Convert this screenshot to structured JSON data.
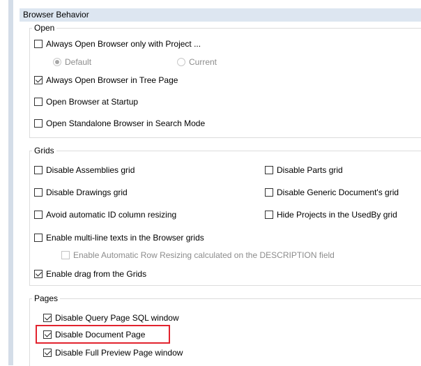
{
  "header": {
    "title": "Browser Behavior"
  },
  "open": {
    "legend": "Open",
    "always_open_project": {
      "label": "Always Open Browser only with Project ...",
      "checked": false
    },
    "radio_default": {
      "label": "Default",
      "selected": true
    },
    "radio_current": {
      "label": "Current",
      "selected": false
    },
    "always_open_tree": {
      "label": "Always Open Browser in Tree Page",
      "checked": true
    },
    "open_at_startup": {
      "label": "Open Browser at Startup",
      "checked": false
    },
    "open_standalone": {
      "label": "Open Standalone Browser in Search Mode",
      "checked": false
    }
  },
  "grids": {
    "legend": "Grids",
    "disable_assemblies": {
      "label": "Disable Assemblies grid",
      "checked": false
    },
    "disable_parts": {
      "label": "Disable Parts grid",
      "checked": false
    },
    "disable_drawings": {
      "label": "Disable Drawings grid",
      "checked": false
    },
    "disable_generic": {
      "label": "Disable Generic Document's grid",
      "checked": false
    },
    "avoid_resizing": {
      "label": "Avoid automatic ID column resizing",
      "checked": false
    },
    "hide_projects": {
      "label": "Hide Projects in the UsedBy grid",
      "checked": false
    },
    "multiline": {
      "label": "Enable multi-line texts in the Browser grids",
      "checked": false
    },
    "auto_row_resize": {
      "label": "Enable Automatic Row Resizing calculated on the DESCRIPTION field",
      "checked": false
    },
    "drag_from_grids": {
      "label": "Enable drag from the Grids",
      "checked": true
    }
  },
  "pages": {
    "legend": "Pages",
    "disable_query_sql": {
      "label": "Disable Query Page SQL window",
      "checked": true
    },
    "disable_document": {
      "label": "Disable Document Page",
      "checked": true
    },
    "disable_full_preview": {
      "label": "Disable Full Preview Page window",
      "checked": true
    }
  },
  "colors": {
    "highlight": "#e2232e",
    "header_bg": "#dde6f1"
  }
}
